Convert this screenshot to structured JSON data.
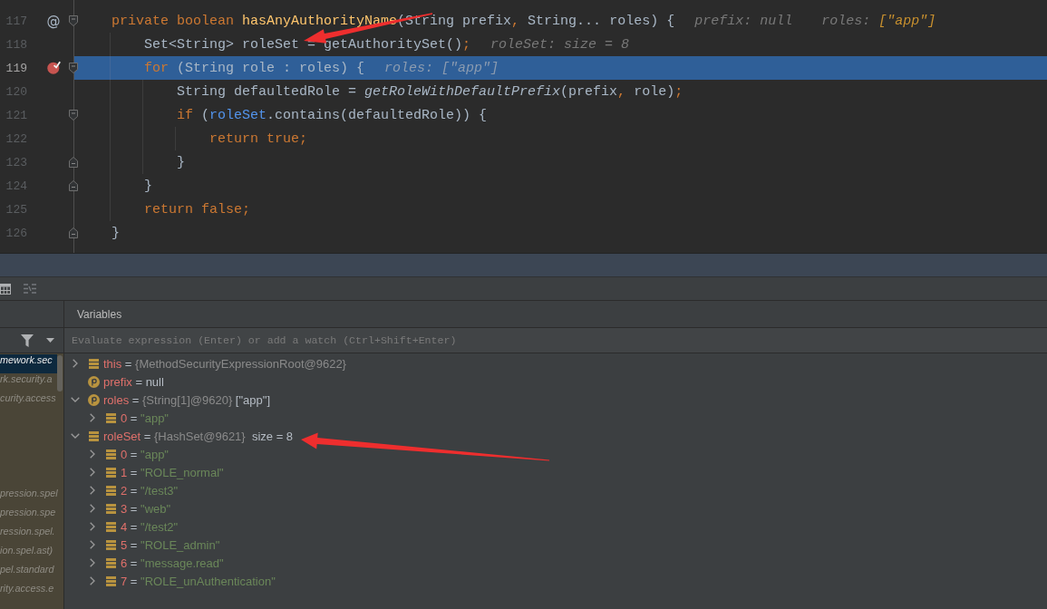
{
  "editor": {
    "lines": [
      {
        "number": "117",
        "gutter_mark": "@",
        "breakpoint": false,
        "current": false,
        "kind": "opener",
        "tokens": [
          {
            "kind": "keyword",
            "text": "private boolean "
          },
          {
            "kind": "declaration",
            "text": "hasAnyAuthorityName"
          },
          {
            "kind": "plain",
            "text": "(String prefix"
          },
          {
            "kind": "keyword",
            "text": ","
          },
          {
            "kind": "plain",
            "text": " String... roles) {"
          }
        ],
        "hints": [
          {
            "name": "prefix:",
            "value": "null",
            "changed": false
          },
          {
            "name": "roles:",
            "value": "[\"app\"]",
            "changed": true
          }
        ],
        "children": [
          {
            "number": "118",
            "breakpoint": false,
            "current": false,
            "kind": "plain",
            "tokens": [
              {
                "kind": "plain",
                "text": "Set<String> roleSet = getAuthoritySet()"
              },
              {
                "kind": "keyword",
                "text": ";"
              }
            ],
            "hints": [
              {
                "name": "roleSet:",
                "value": "size = 8",
                "changed": false
              }
            ]
          },
          {
            "number": "119",
            "breakpoint": true,
            "current": true,
            "kind": "opener",
            "tokens": [
              {
                "kind": "keyword",
                "text": "for"
              },
              {
                "kind": "plain",
                "text": " (String role : roles) {"
              }
            ],
            "hints": [
              {
                "name": "roles:",
                "value": "[\"app\"]",
                "changed": false
              }
            ],
            "children": [
              {
                "number": "120",
                "breakpoint": false,
                "current": false,
                "kind": "plain",
                "tokens": [
                  {
                    "kind": "plain",
                    "text": "String defaultedRole = "
                  },
                  {
                    "kind": "static_call",
                    "text": "getRoleWithDefaultPrefix"
                  },
                  {
                    "kind": "plain",
                    "text": "(prefix"
                  },
                  {
                    "kind": "keyword",
                    "text": ","
                  },
                  {
                    "kind": "plain",
                    "text": " role)"
                  },
                  {
                    "kind": "keyword",
                    "text": ";"
                  }
                ]
              },
              {
                "number": "121",
                "breakpoint": false,
                "current": false,
                "kind": "opener",
                "tokens": [
                  {
                    "kind": "keyword",
                    "text": "if"
                  },
                  {
                    "kind": "plain",
                    "text": " ("
                  },
                  {
                    "kind": "local",
                    "text": "roleSet"
                  },
                  {
                    "kind": "plain",
                    "text": ".contains(defaultedRole)) {"
                  }
                ],
                "children": [
                  {
                    "number": "122",
                    "breakpoint": false,
                    "current": false,
                    "kind": "plain",
                    "tokens": [
                      {
                        "kind": "keyword",
                        "text": "return true;"
                      }
                    ]
                  }
                ]
              },
              {
                "number": "123",
                "breakpoint": false,
                "current": false,
                "kind": "closer",
                "tokens": [
                  {
                    "kind": "plain",
                    "text": "}"
                  }
                ]
              }
            ]
          },
          {
            "number": "124",
            "breakpoint": false,
            "current": false,
            "kind": "closer",
            "tokens": [
              {
                "kind": "plain",
                "text": "}"
              }
            ]
          },
          {
            "number": "125",
            "breakpoint": false,
            "current": false,
            "kind": "plain",
            "tokens": [
              {
                "kind": "keyword",
                "text": "return false;"
              }
            ]
          }
        ]
      },
      {
        "number": "126",
        "breakpoint": false,
        "current": false,
        "kind": "closer",
        "tokens": [
          {
            "kind": "plain",
            "text": "}"
          }
        ]
      }
    ]
  },
  "debugger": {
    "frames": [
      {
        "text": "mework.sec",
        "selected": true
      },
      {
        "text": "rk.security.a",
        "selected": false
      },
      {
        "text": "curity.access",
        "selected": false
      },
      {
        "selected": false
      },
      {
        "selected": false
      },
      {
        "selected": false
      },
      {
        "selected": false
      },
      {
        "text": "pression.spel",
        "selected": false
      },
      {
        "text": "pression.spe",
        "selected": false
      },
      {
        "text": "ression.spel.",
        "selected": false
      },
      {
        "text": "ion.spel.ast)",
        "selected": false
      },
      {
        "text": "pel.standard",
        "selected": false
      },
      {
        "text": "rity.access.e",
        "selected": false
      }
    ],
    "variables": {
      "title": "Variables",
      "evaluate": {
        "placeholder": "Evaluate expression (Enter) or add a watch (Ctrl+Shift+Enter)"
      },
      "nodes": [
        {
          "kind": "field",
          "expanded": false,
          "parts": [
            {
              "kind": "name",
              "text": "this"
            },
            {
              "kind": "plain",
              "text": " = "
            },
            {
              "kind": "ref",
              "text": "{MethodSecurityExpressionRoot@9622}"
            }
          ]
        },
        {
          "kind": "parameter",
          "parts": [
            {
              "kind": "name",
              "text": "prefix"
            },
            {
              "kind": "plain",
              "text": " = "
            },
            {
              "kind": "plain",
              "text": "null"
            }
          ]
        },
        {
          "kind": "parameter",
          "expanded": true,
          "parts": [
            {
              "kind": "name",
              "text": "roles"
            },
            {
              "kind": "plain",
              "text": " = "
            },
            {
              "kind": "ref",
              "text": "{String[1]@9620}"
            },
            {
              "kind": "plain",
              "text": " [\"app\"]"
            }
          ],
          "children": [
            {
              "kind": "field",
              "expanded": false,
              "parts": [
                {
                  "kind": "name",
                  "text": "0"
                },
                {
                  "kind": "plain",
                  "text": " = "
                },
                {
                  "kind": "string",
                  "text": "\"app\""
                }
              ]
            }
          ]
        },
        {
          "kind": "field",
          "expanded": true,
          "parts": [
            {
              "kind": "name",
              "text": "roleSet"
            },
            {
              "kind": "plain",
              "text": " = "
            },
            {
              "kind": "ref",
              "text": "{HashSet@9621}"
            },
            {
              "kind": "plain",
              "text": "  size = 8"
            }
          ],
          "children": [
            {
              "kind": "field",
              "expanded": false,
              "parts": [
                {
                  "kind": "name",
                  "text": "0"
                },
                {
                  "kind": "plain",
                  "text": " = "
                },
                {
                  "kind": "string",
                  "text": "\"app\""
                }
              ]
            },
            {
              "kind": "field",
              "expanded": false,
              "parts": [
                {
                  "kind": "name",
                  "text": "1"
                },
                {
                  "kind": "plain",
                  "text": " = "
                },
                {
                  "kind": "string",
                  "text": "\"ROLE_normal\""
                }
              ]
            },
            {
              "kind": "field",
              "expanded": false,
              "parts": [
                {
                  "kind": "name",
                  "text": "2"
                },
                {
                  "kind": "plain",
                  "text": " = "
                },
                {
                  "kind": "string",
                  "text": "\"/test3\""
                }
              ]
            },
            {
              "kind": "field",
              "expanded": false,
              "parts": [
                {
                  "kind": "name",
                  "text": "3"
                },
                {
                  "kind": "plain",
                  "text": " = "
                },
                {
                  "kind": "string",
                  "text": "\"web\""
                }
              ]
            },
            {
              "kind": "field",
              "expanded": false,
              "parts": [
                {
                  "kind": "name",
                  "text": "4"
                },
                {
                  "kind": "plain",
                  "text": " = "
                },
                {
                  "kind": "string",
                  "text": "\"/test2\""
                }
              ]
            },
            {
              "kind": "field",
              "expanded": false,
              "parts": [
                {
                  "kind": "name",
                  "text": "5"
                },
                {
                  "kind": "plain",
                  "text": " = "
                },
                {
                  "kind": "string",
                  "text": "\"ROLE_admin\""
                }
              ]
            },
            {
              "kind": "field",
              "expanded": false,
              "parts": [
                {
                  "kind": "name",
                  "text": "6"
                },
                {
                  "kind": "plain",
                  "text": " = "
                },
                {
                  "kind": "string",
                  "text": "\"message.read\""
                }
              ]
            },
            {
              "kind": "field",
              "expanded": false,
              "parts": [
                {
                  "kind": "name",
                  "text": "7"
                },
                {
                  "kind": "plain",
                  "text": " = "
                },
                {
                  "kind": "string",
                  "text": "\"ROLE_unAuthentication\""
                }
              ]
            }
          ]
        }
      ]
    }
  }
}
